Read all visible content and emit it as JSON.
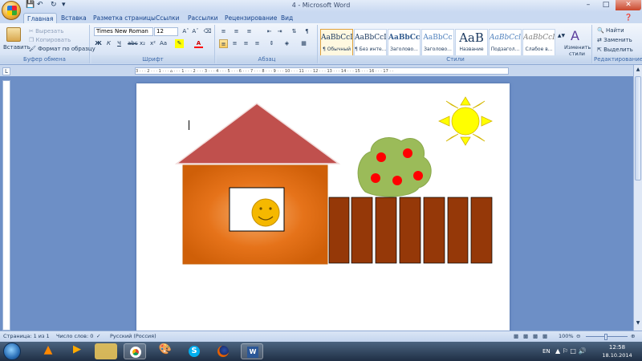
{
  "window": {
    "title": "4 - Microsoft Word"
  },
  "tabs": [
    {
      "label": "Главная"
    },
    {
      "label": "Вставка"
    },
    {
      "label": "Разметка страницы"
    },
    {
      "label": "Ссылки"
    },
    {
      "label": "Рассылки"
    },
    {
      "label": "Рецензирование"
    },
    {
      "label": "Вид"
    }
  ],
  "clipboard": {
    "paste": "Вставить",
    "cut": "Вырезать",
    "copy": "Копировать",
    "format_painter": "Формат по образцу",
    "label": "Буфер обмена"
  },
  "font": {
    "name": "Times New Roman",
    "size": "12",
    "label": "Шрифт"
  },
  "paragraph": {
    "label": "Абзац"
  },
  "styles": {
    "label": "Стили",
    "items": [
      {
        "sample": "AaBbCcI",
        "name": "¶ Обычный"
      },
      {
        "sample": "AaBbCcI",
        "name": "¶ Без инте..."
      },
      {
        "sample": "AaBbCc",
        "name": "Заголово..."
      },
      {
        "sample": "AaBbCc",
        "name": "Заголово..."
      },
      {
        "sample": "AaB",
        "name": "Название"
      },
      {
        "sample": "AaBbCcl",
        "name": "Подзагол..."
      },
      {
        "sample": "AaBbCcI",
        "name": "Слабое в..."
      }
    ],
    "change": "Изменить стили"
  },
  "editing": {
    "find": "Найти",
    "replace": "Заменить",
    "select": "Выделить",
    "label": "Редактирование"
  },
  "ruler": {
    "text": "3 · · · 2 · · · 1 · · · ⌂ · · · 1 · · · 2 · · · 3 · · · 4 · · · 5 · · · 6 · · · 7 · · · 8 · · · 9 · · · 10 · · · 11 · · · 12 · · · 13 · · · 14 · · · 15 · · · 16 · · · 17 · ·"
  },
  "status": {
    "page": "Страница: 1 из 1",
    "words": "Число слов: 0",
    "language": "Русский (Россия)",
    "zoom": "100%"
  },
  "taskbar": {
    "lang": "EN",
    "time": "12:58",
    "date": "18.10.2014"
  },
  "colors": {
    "roof": "#c0504d",
    "wall": "#e36c09",
    "fence": "#953808",
    "sun": "#ffff00",
    "tree": "#9bbb59",
    "apple": "#ff0000",
    "smiley": "#f5b800"
  }
}
